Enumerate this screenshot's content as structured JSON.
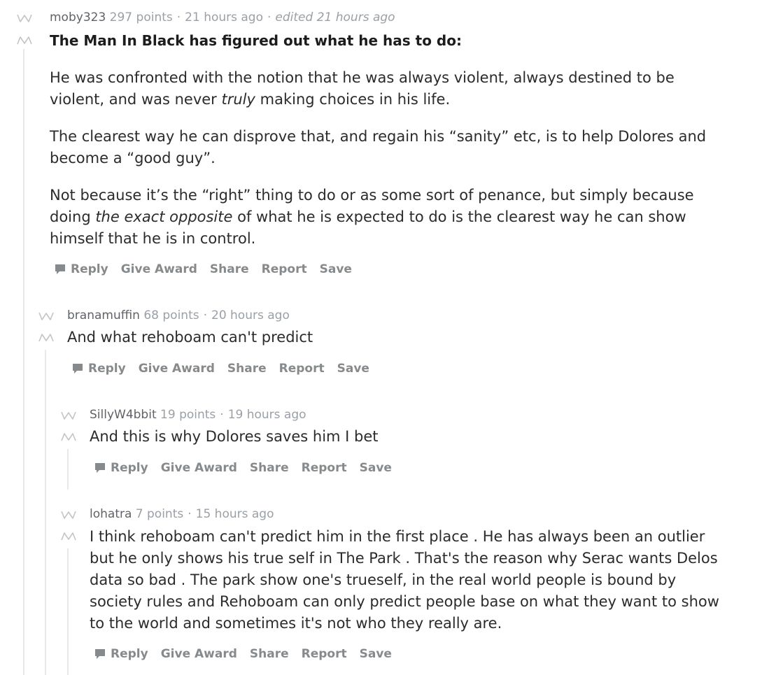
{
  "comments": [
    {
      "author": "moby323",
      "points": "297 points",
      "time": "21 hours ago",
      "edited": "edited 21 hours ago",
      "title": "The Man In Black has figured out what he has to do:",
      "para1a": "He was confronted with the notion that he was always violent, always destined to be violent, and was never ",
      "para1em": "truly",
      "para1b": " making choices in his life.",
      "para2": "The clearest way he can disprove that, and regain his “sanity” etc, is to help Dolores and become a “good guy”.",
      "para3a": "Not because it’s the “right” thing to do or as some sort of penance, but simply because doing ",
      "para3em": "the exact opposite",
      "para3b": " of what he is expected to do is the clearest way he can show himself that he is in control."
    },
    {
      "author": "branamuffin",
      "points": "68 points",
      "time": "20 hours ago",
      "body": "And what rehoboam can't predict"
    },
    {
      "author": "SillyW4bbit",
      "points": "19 points",
      "time": "19 hours ago",
      "body": "And this is why Dolores saves him I bet"
    },
    {
      "author": "lohatra",
      "points": "7 points",
      "time": "15 hours ago",
      "body": "I think rehoboam can't predict him in the first place . He has always been an outlier but he only shows his true self in The Park . That's the reason why Serac wants Delos data so bad . The park show one's trueself, in the real world people is bound by society rules and Rehoboam can only predict people base on what they want to show to the world and sometimes it's not who they really are."
    }
  ],
  "actions": {
    "reply": "Reply",
    "give_award": "Give Award",
    "share": "Share",
    "report": "Report",
    "save": "Save"
  },
  "icons": {
    "upvote": "upvote-icon",
    "downvote": "downvote-icon",
    "reply": "chat-bubble-icon"
  },
  "colors": {
    "meta_grey": "#9aa0a6",
    "action_grey": "#878a8c",
    "thread_line": "#e8e8e8"
  }
}
